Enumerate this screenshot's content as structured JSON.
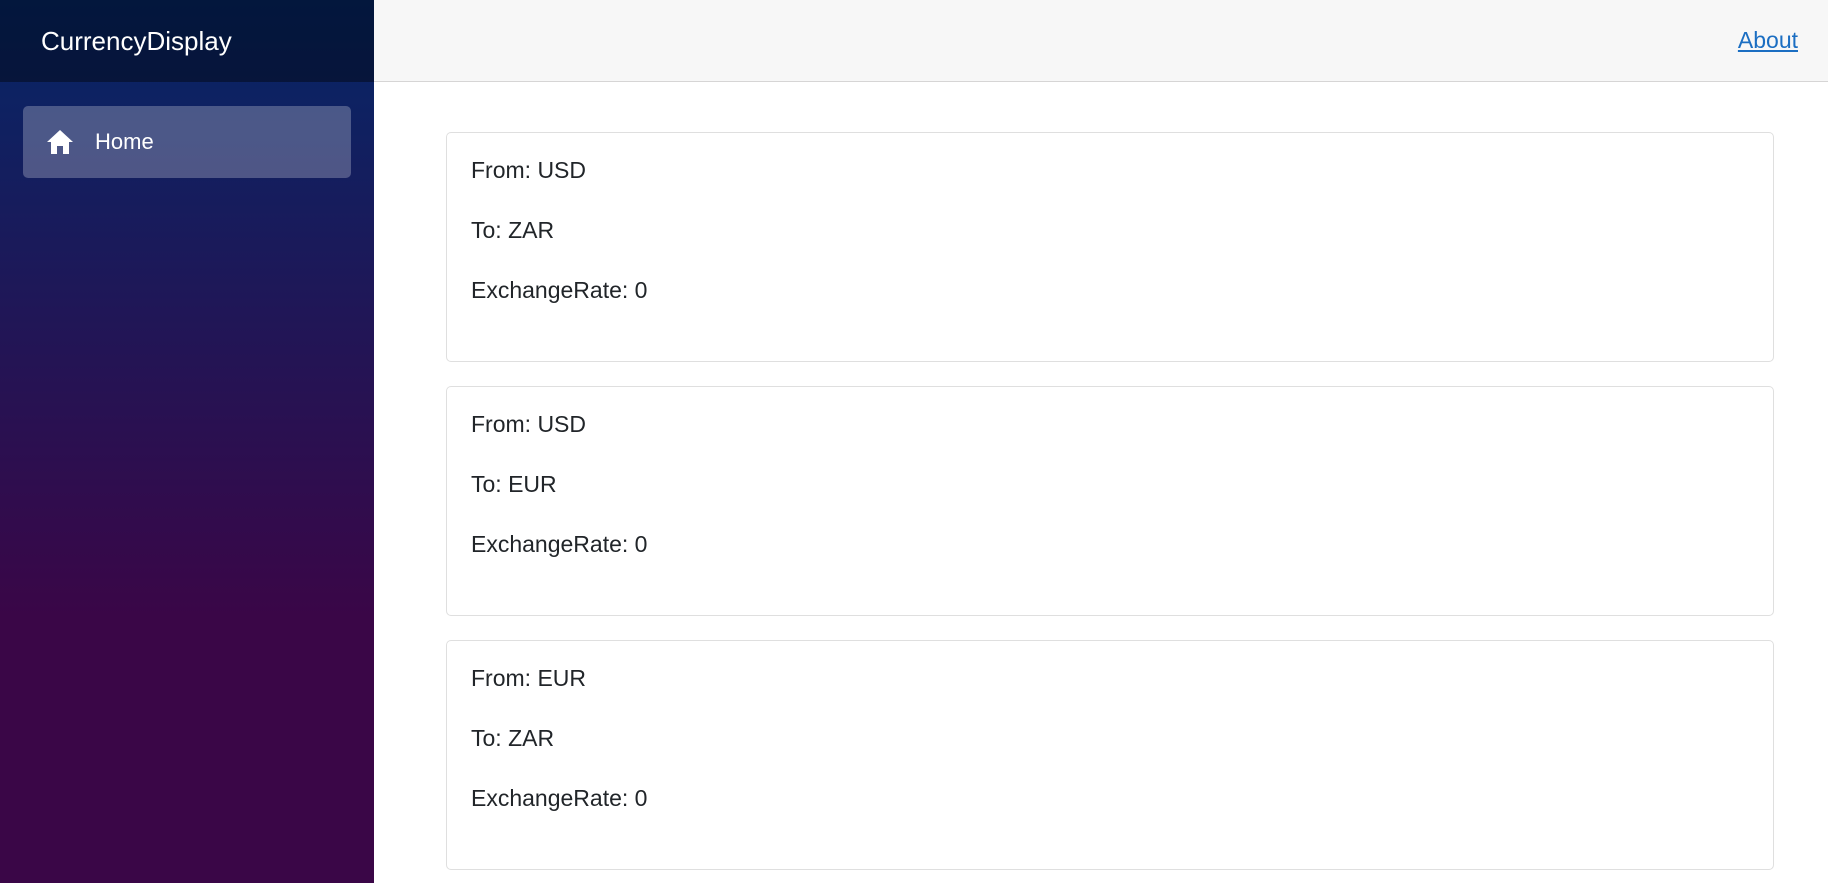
{
  "app": {
    "brand": "CurrencyDisplay"
  },
  "sidebar": {
    "items": [
      {
        "label": "Home",
        "icon": "home-icon"
      }
    ]
  },
  "header": {
    "about_link": "About"
  },
  "cards": [
    {
      "from": "From: USD",
      "to": "To: ZAR",
      "rate": "ExchangeRate: 0"
    },
    {
      "from": "From: USD",
      "to": "To: EUR",
      "rate": "ExchangeRate: 0"
    },
    {
      "from": "From: EUR",
      "to": "To: ZAR",
      "rate": "ExchangeRate: 0"
    }
  ],
  "colors": {
    "sidebar_top": "#052767",
    "sidebar_bottom": "#3a0647",
    "link": "#1b6ec2"
  }
}
